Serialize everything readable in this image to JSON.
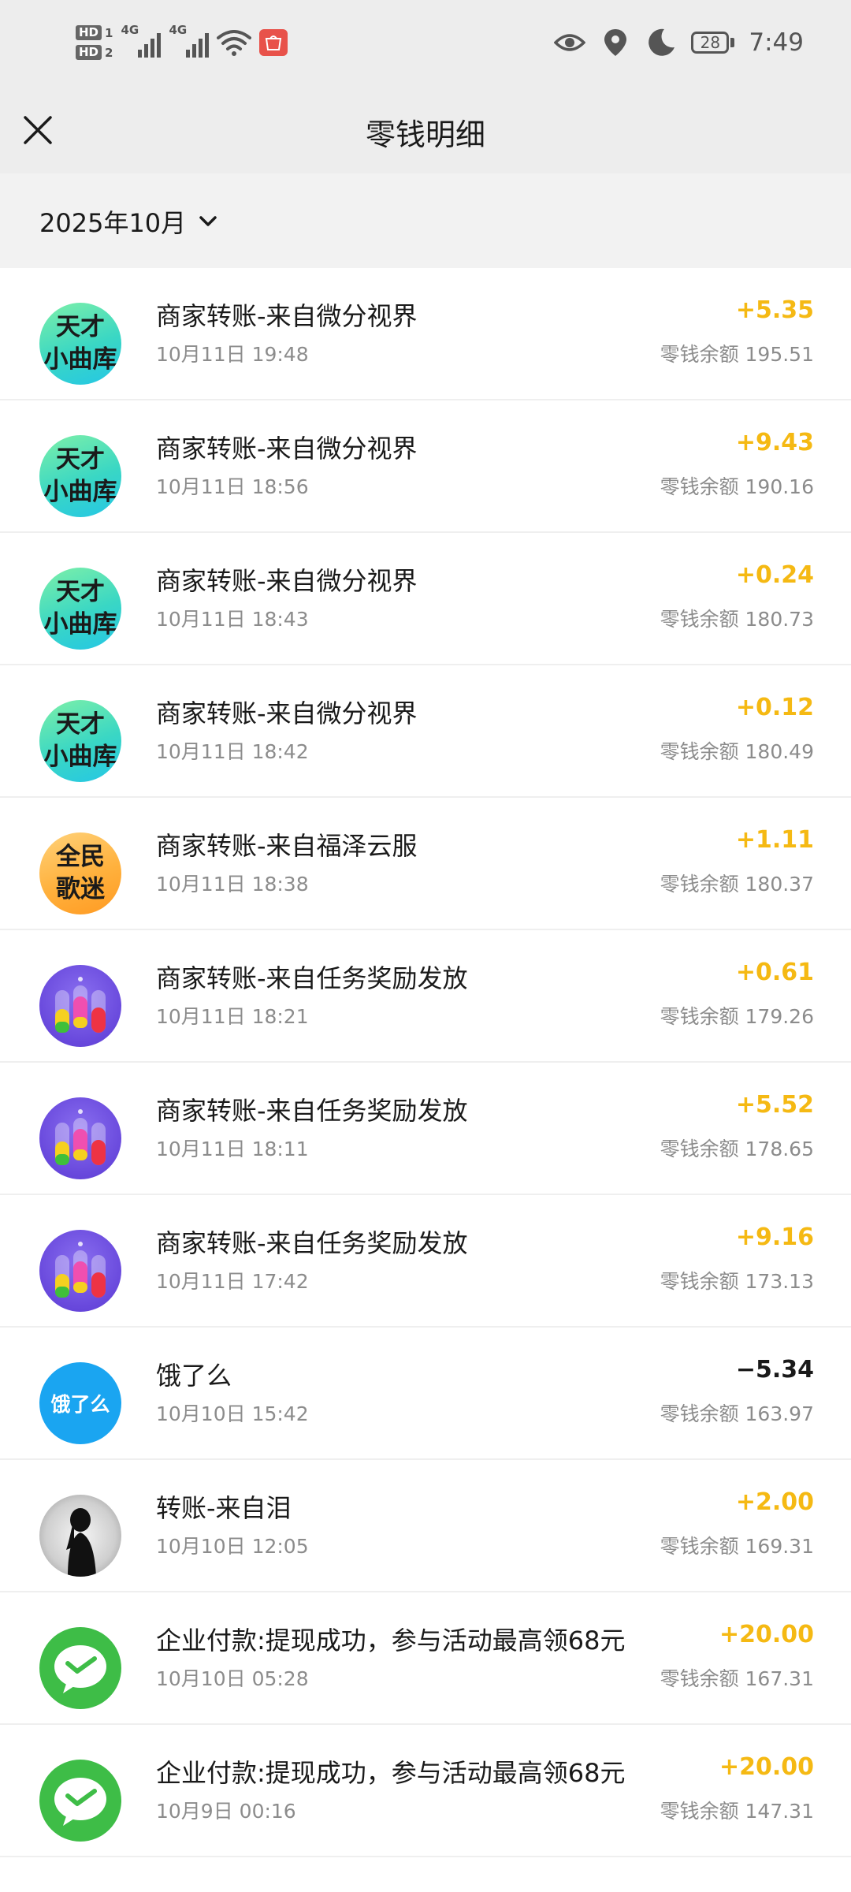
{
  "status_bar": {
    "hd1": "HD",
    "hd1_num": "1",
    "hd2": "HD",
    "hd2_num": "2",
    "network1": "4G",
    "network2": "4G",
    "battery": "28",
    "time": "7:49"
  },
  "header": {
    "title": "零钱明细"
  },
  "filter": {
    "month": "2025年10月"
  },
  "colors": {
    "income": "#f5b913",
    "expense": "#1a1a1a",
    "header_bg": "#ededed"
  },
  "transactions": [
    {
      "avatar": "天才\n小曲库",
      "title": "商家转账-来自微分视界",
      "time": "10月11日 19:48",
      "amount": "+5.35",
      "balance": "零钱余额 195.51"
    },
    {
      "avatar": "天才\n小曲库",
      "title": "商家转账-来自微分视界",
      "time": "10月11日 18:56",
      "amount": "+9.43",
      "balance": "零钱余额 190.16"
    },
    {
      "avatar": "天才\n小曲库",
      "title": "商家转账-来自微分视界",
      "time": "10月11日 18:43",
      "amount": "+0.24",
      "balance": "零钱余额 180.73"
    },
    {
      "avatar": "天才\n小曲库",
      "title": "商家转账-来自微分视界",
      "time": "10月11日 18:42",
      "amount": "+0.12",
      "balance": "零钱余额 180.49"
    },
    {
      "avatar": "全民\n歌迷",
      "title": "商家转账-来自福泽云服",
      "time": "10月11日 18:38",
      "amount": "+1.11",
      "balance": "零钱余额 180.37"
    },
    {
      "avatar": "bottles-icon",
      "title": "商家转账-来自任务奖励发放",
      "time": "10月11日 18:21",
      "amount": "+0.61",
      "balance": "零钱余额 179.26"
    },
    {
      "avatar": "bottles-icon",
      "title": "商家转账-来自任务奖励发放",
      "time": "10月11日 18:11",
      "amount": "+5.52",
      "balance": "零钱余额 178.65"
    },
    {
      "avatar": "bottles-icon",
      "title": "商家转账-来自任务奖励发放",
      "time": "10月11日 17:42",
      "amount": "+9.16",
      "balance": "零钱余额 173.13"
    },
    {
      "avatar": "饿了么",
      "title": "饿了么",
      "time": "10月10日 15:42",
      "amount": "−5.34",
      "balance": "零钱余额 163.97"
    },
    {
      "avatar": "user-photo",
      "title": "转账-来自泪",
      "time": "10月10日 12:05",
      "amount": "+2.00",
      "balance": "零钱余额 169.31"
    },
    {
      "avatar": "wechat-pay-icon",
      "title": "企业付款:提现成功，参与活动最高领68元",
      "time": "10月10日 05:28",
      "amount": "+20.00",
      "balance": "零钱余额 167.31"
    },
    {
      "avatar": "wechat-pay-icon",
      "title": "企业付款:提现成功，参与活动最高领68元",
      "time": "10月9日 00:16",
      "amount": "+20.00",
      "balance": "零钱余额 147.31"
    }
  ]
}
